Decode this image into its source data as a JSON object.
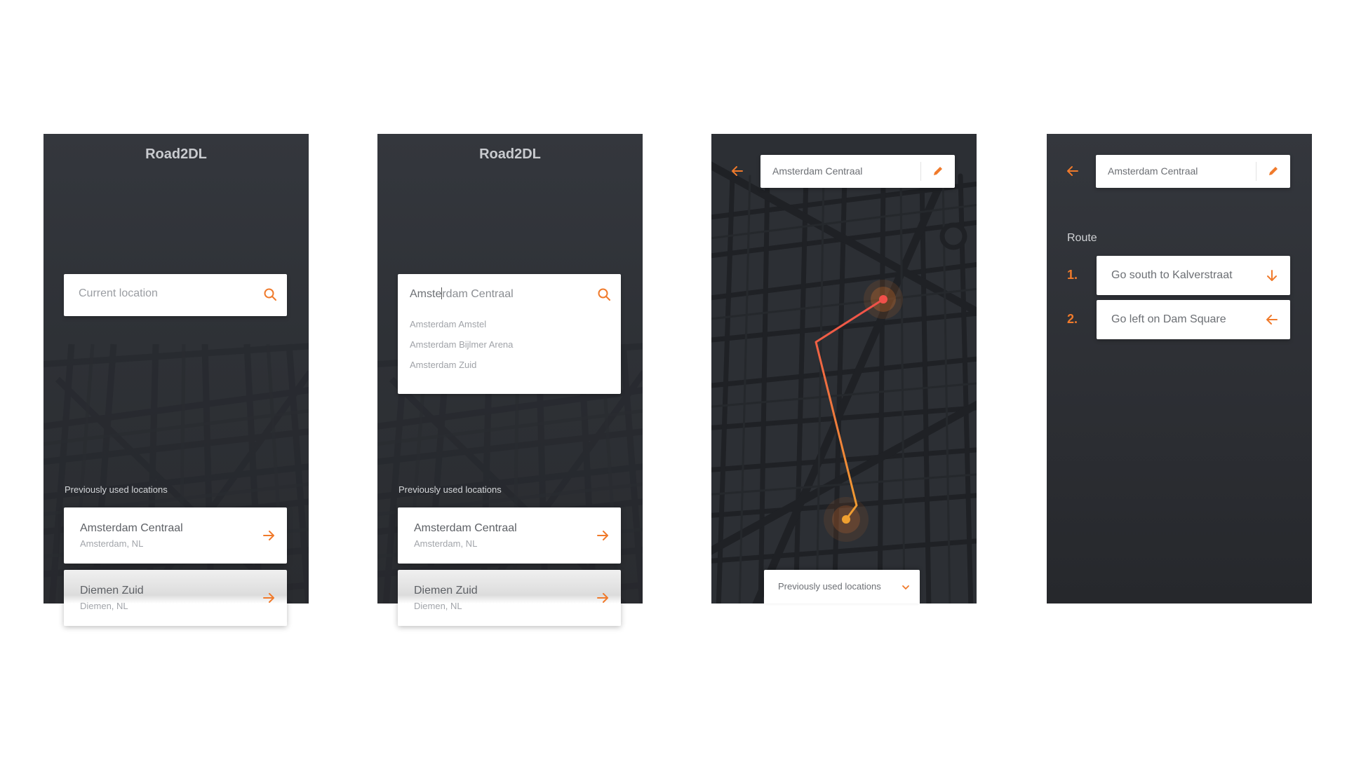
{
  "colors": {
    "accent": "#f07a2b",
    "route_start": "#f0a030",
    "route_end": "#f0504a",
    "screen_bg": "#2e3136"
  },
  "screen1": {
    "app_title": "Road2DL",
    "search_placeholder": "Current location",
    "section_label": "Previously used locations",
    "cards": [
      {
        "title": "Amsterdam Centraal",
        "subtitle": "Amsterdam, NL"
      },
      {
        "title": "Diemen Zuid",
        "subtitle": "Diemen, NL"
      }
    ]
  },
  "screen2": {
    "app_title": "Road2DL",
    "search_typed": "Amste",
    "search_completion": "rdam Centraal",
    "suggestions": [
      "Amsterdam Amstel",
      "Amsterdam Bijlmer Arena",
      "Amsterdam Zuid"
    ],
    "section_label": "Previously used locations",
    "cards": [
      {
        "title": "Amsterdam Centraal",
        "subtitle": "Amsterdam, NL"
      },
      {
        "title": "Diemen Zuid",
        "subtitle": "Diemen, NL"
      }
    ]
  },
  "screen3": {
    "destination": "Amsterdam Centraal",
    "prev_locations_label": "Previously used locations",
    "icons": {
      "back": "arrow-left-icon",
      "edit": "pencil-icon",
      "toggle": "chevron-down-icon"
    }
  },
  "screen4": {
    "destination": "Amsterdam Centraal",
    "route_label": "Route",
    "steps": [
      {
        "number": "1.",
        "text": "Go south to Kalverstraat",
        "icon": "arrow-down-icon"
      },
      {
        "number": "2.",
        "text": "Go left on Dam Square",
        "icon": "arrow-left-icon"
      }
    ]
  }
}
